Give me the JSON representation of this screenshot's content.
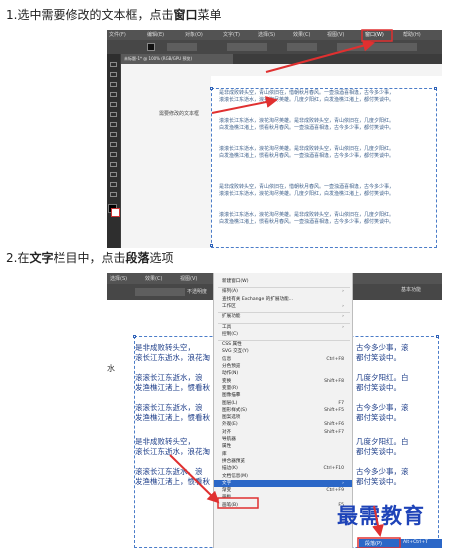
{
  "step1": {
    "prefix": "1.选中需要修改的文本框，点击",
    "bold": "窗口",
    "suffix": "菜单"
  },
  "step2": {
    "prefix": "2.在",
    "bold1": "文字",
    "middle": "栏目中，点击",
    "bold2": "段落",
    "suffix": "选项"
  },
  "shot1": {
    "menubar": [
      "文件(F)",
      "编辑(E)",
      "对象(O)",
      "文字(T)",
      "选择(S)",
      "效果(C)",
      "视图(V)",
      "窗口(W)",
      "帮助(H)"
    ],
    "doc_tab": "未标题-1* @ 100% (RGB/GPU 预览)",
    "label": "需要修改的文本框",
    "paragraphs": [
      [
        "是非成败转头空，青山依旧在，惜朝秋月春风。一壶浊酒喜相逢，古今多少事，",
        "滚滚长江东逝水，浪花淘尽英雄。几度夕阳红，白发渔樵江渚上，都付笑谈中。"
      ],
      [
        "滚滚长江东逝水，浪花淘尽英雄。是非成败转头空，青山依旧在，几度夕阳红。",
        "白发渔樵江渚上，惯看秋月春风。一壶浊酒喜相逢，古今多少事，都付笑谈中。"
      ],
      [
        "滚滚长江东逝水，浪花淘尽英雄。是非成败转头空，青山依旧在，几度夕阳红。",
        "白发渔樵江渚上，惯看秋月春风。一壶浊酒喜相逢，古今多少事，都付笑谈中。"
      ],
      [
        "是非成败转头空，青山依旧在，惜朝秋月春风。一壶浊酒喜相逢，古今多少事，",
        "滚滚长江东逝水，浪花淘尽英雄。几度夕阳红，白发渔樵江渚上，都付笑谈中。"
      ],
      [
        "滚滚长江东逝水，浪花淘尽英雄。是非成败转头空，青山依旧在，几度夕阳红。",
        "白发渔樵江渚上，惯看秋月春风。一壶浊酒喜相逢，古今多少事，都付笑谈中。"
      ]
    ]
  },
  "shot2": {
    "menubar": [
      "选择(S)",
      "效果(C)",
      "视图(V)"
    ],
    "right_label": "基本功能",
    "ctrl_label": "不透明度",
    "water_char": "水",
    "text_lines": [
      [
        "是非成败转头空，",
        "滚长江东逝水，浪花淘"
      ],
      [
        "滚滚长江东逝水，浪",
        "发渔樵江渚上，惯看秋"
      ],
      [
        "滚滚长江东逝水，浪",
        "发渔樵江渚上，惯看秋"
      ],
      [
        "是非成败转头空，",
        "滚长江东逝水，浪花淘"
      ],
      [
        "滚滚长江东逝水，浪",
        "发渔樵江渚上，惯看秋"
      ]
    ],
    "right_text": [
      [
        "古今多少事，滚",
        "都付笑谈中。"
      ],
      [
        "几度夕阳红。白",
        "都付笑谈中。"
      ],
      [
        "古今多少事，滚",
        "都付笑谈中。"
      ],
      [
        "几度夕阳红。白",
        "都付笑谈中。"
      ],
      [
        "古今多少事，滚",
        "都付笑谈中。"
      ]
    ],
    "dropdown": [
      {
        "label": "新建窗口(W)"
      },
      {
        "sep": true
      },
      {
        "label": "排列(A)",
        "arrow": "›"
      },
      {
        "label": "查找有关 Exchange 的扩展功能..."
      },
      {
        "label": "工作区",
        "arrow": "›"
      },
      {
        "sep": true
      },
      {
        "label": "扩展功能",
        "arrow": "›"
      },
      {
        "sep": true
      },
      {
        "label": "工具",
        "arrow": "›"
      },
      {
        "label": "控制(C)"
      },
      {
        "sep": true
      },
      {
        "label": "CSS 属性"
      },
      {
        "label": "SVG 交互(Y)"
      },
      {
        "label": "信息",
        "shortcut": "Ctrl+F8"
      },
      {
        "label": "分色预览"
      },
      {
        "label": "动作(N)"
      },
      {
        "label": "变换",
        "shortcut": "Shift+F8"
      },
      {
        "label": "变量(R)"
      },
      {
        "label": "图像描摹"
      },
      {
        "label": "图层(L)",
        "shortcut": "F7"
      },
      {
        "label": "图形样式(S)",
        "shortcut": "Shift+F5"
      },
      {
        "label": "图案选项"
      },
      {
        "label": "外观(E)",
        "shortcut": "Shift+F6"
      },
      {
        "label": "对齐",
        "shortcut": "Shift+F7"
      },
      {
        "label": "导航器"
      },
      {
        "label": "属性"
      },
      {
        "label": "库"
      },
      {
        "label": "拼合器预览"
      },
      {
        "label": "描边(K)",
        "shortcut": "Ctrl+F10"
      },
      {
        "label": "文档信息(M)"
      },
      {
        "label": "文字",
        "arrow": "›",
        "highlight": true
      },
      {
        "label": "渐变",
        "shortcut": "Ctrl+F9"
      },
      {
        "label": "画板"
      },
      {
        "label": "画笔(B)",
        "shortcut": "F5"
      }
    ],
    "submenu_item": "段落(P)",
    "submenu_shortcut": "Alt+Ctrl+T"
  },
  "watermark": "最需教育",
  "colors": {
    "highlight": "#2b67c7",
    "arrow_red": "#e03030",
    "text_blue": "#1f3f8a"
  }
}
